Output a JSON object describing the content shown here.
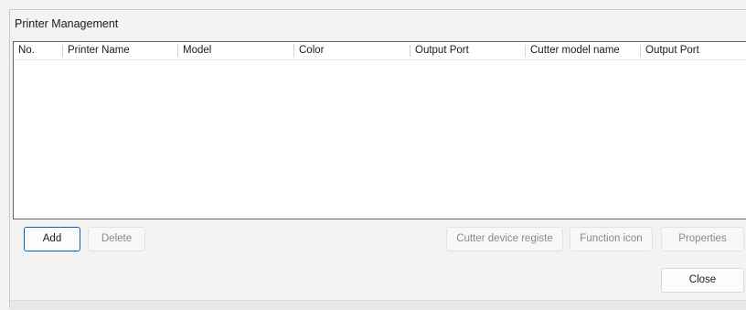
{
  "window": {
    "title": "Printer Management"
  },
  "table": {
    "columns": [
      "No.",
      "Printer Name",
      "Model",
      "Color",
      "Output Port",
      "Cutter model name",
      "Output Port"
    ],
    "rows": []
  },
  "buttons": {
    "add": "Add",
    "delete": "Delete",
    "cutter_device_register": "Cutter device registe",
    "function_icon": "Function icon",
    "properties": "Properties",
    "close": "Close"
  },
  "colors": {
    "default_button_border": "#0067c0",
    "list_border": "#646464"
  }
}
